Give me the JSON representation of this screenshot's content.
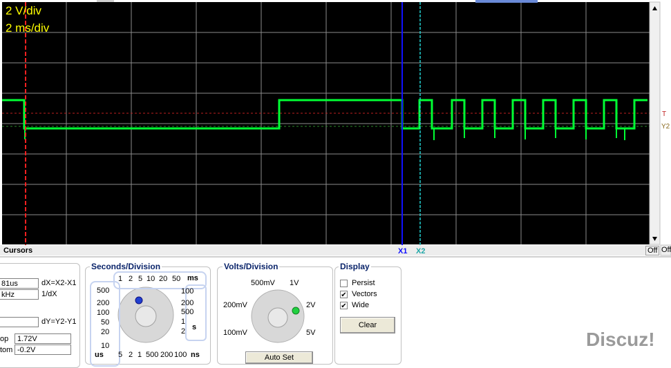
{
  "scope": {
    "volts_per_div": "2 V/div",
    "time_per_div": "2 ms/div",
    "cursors_label": "Cursors",
    "x1_label": "X1",
    "x2_label": "X2",
    "t_marker": "T",
    "y_marker": "Y2",
    "off_label_1": "Off",
    "off_label_2": "Off",
    "colors": {
      "trace": "#00ff33",
      "grid": "#8c8c8c",
      "x1": "#1010ff",
      "x2": "#22d0d0",
      "cursor_red": "#ff2020",
      "text": "#ffff00"
    }
  },
  "cursor_panel": {
    "dx_value": "81us",
    "dx_label": "dX=X2-X1",
    "freq_value": "kHz",
    "freq_label": "1/dX",
    "dy_value": "",
    "dy_label": "dY=Y2-Y1",
    "top_label": "op",
    "top_value": "1.72V",
    "bottom_label": "tom",
    "bottom_value": "-0.2V"
  },
  "seconds_division": {
    "title": "Seconds/Division",
    "top_row": [
      "1",
      "2",
      "5",
      "10",
      "20",
      "50"
    ],
    "ms_unit": "ms",
    "right_col": [
      "100",
      "200",
      "500",
      "1",
      "2"
    ],
    "s_unit": "s",
    "left_col": [
      "500",
      "200",
      "100",
      "50",
      "20",
      "10"
    ],
    "us_unit": "us",
    "bottom_row": [
      "5",
      "2",
      "1",
      "500",
      "200",
      "100"
    ],
    "ns_unit": "ns"
  },
  "volts_division": {
    "title": "Volts/Division",
    "labels": [
      "500mV",
      "1V",
      "200mV",
      "2V",
      "100mV",
      "5V"
    ],
    "auto_button": "Auto Set"
  },
  "display": {
    "title": "Display",
    "persist": "Persist",
    "vectors": "Vectors",
    "wide": "Wide",
    "persist_checked": false,
    "vectors_checked": true,
    "wide_checked": true,
    "clear_button": "Clear"
  },
  "watermark": "Discuz!"
}
